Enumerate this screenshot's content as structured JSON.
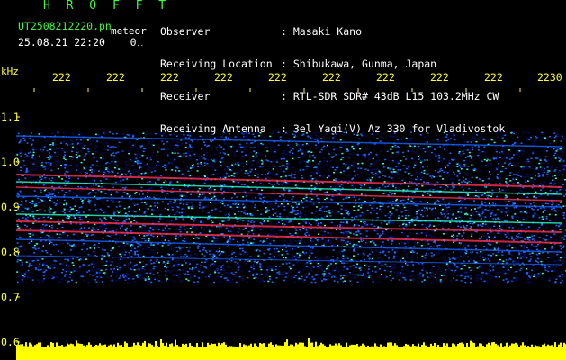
{
  "header": {
    "brand": "H R O F F T",
    "file_name": "UT2508212220.pn",
    "file_tag": "meteor",
    "timestamp": "25.08.21 22:20",
    "zero_marker": "0",
    "info_lines": [
      {
        "label": "Observer",
        "value": ": Masaki Kano"
      },
      {
        "label": "Receiving Location",
        "value": ": Shibukawa, Gunma, Japan"
      },
      {
        "label": "Receiver",
        "value": ": RTL-SDR SDR# 43dB L15 103.2MHz CW"
      },
      {
        "label": "Receiving Antenna",
        "value": ": 3el Yagi(V) Az 330 for Vladivostok"
      }
    ]
  },
  "axis": {
    "unit": "kHz",
    "time_ticks": [
      "222",
      "222",
      "222",
      "222",
      "222",
      "222",
      "222",
      "222",
      "222",
      "2230"
    ],
    "freq_ticks": [
      "1.1",
      "1.0",
      "0.9",
      "0.8",
      "0.7",
      "0.6"
    ]
  },
  "colors": {
    "background": "#000000",
    "header_text": "#39ff39",
    "info_text": "#ffffff",
    "axis_text": "#ffff33",
    "spectrum_low": "#000a66",
    "spectrum_mid": "#1a66ff",
    "spectrum_high": "#33ffcc",
    "spectrum_peak": "#ff3355",
    "meter_bar": "#ffff00"
  }
}
